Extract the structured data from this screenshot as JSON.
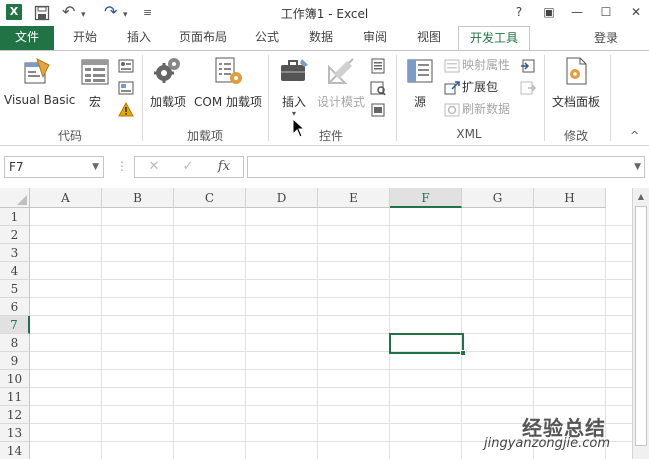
{
  "window": {
    "title": "工作簿1 - Excel",
    "app_logo": "X",
    "controls": [
      "?",
      "▣",
      "—",
      "☐",
      "✕"
    ]
  },
  "qat": {
    "undo": "↶",
    "redo": "↷",
    "customize": "≡"
  },
  "tabs": [
    {
      "label": "文件"
    },
    {
      "label": "开始"
    },
    {
      "label": "插入"
    },
    {
      "label": "页面布局"
    },
    {
      "label": "公式"
    },
    {
      "label": "数据"
    },
    {
      "label": "审阅"
    },
    {
      "label": "视图"
    },
    {
      "label": "开发工具"
    }
  ],
  "account": {
    "login": "登录"
  },
  "ribbon": {
    "groups": {
      "code": {
        "label": "代码",
        "visual_basic": "Visual Basic",
        "macros": "宏"
      },
      "addins": {
        "label": "加载项",
        "addins_btn": "加载项",
        "com_addins": "COM 加载项"
      },
      "controls": {
        "label": "控件",
        "insert": "插入",
        "design_mode": "设计模式"
      },
      "xml": {
        "label": "XML",
        "source": "源",
        "map_properties": "映射属性",
        "expansion_packs": "扩展包",
        "refresh_data": "刷新数据"
      },
      "modify": {
        "label": "修改",
        "document_panel": "文档面板"
      }
    },
    "collapse": "^"
  },
  "formula_bar": {
    "name_box": "F7",
    "fx": "fx",
    "cancel": "✕",
    "enter": "✓",
    "formula": ""
  },
  "sheet": {
    "columns": [
      "A",
      "B",
      "C",
      "D",
      "E",
      "F",
      "G",
      "H"
    ],
    "rows": [
      "1",
      "2",
      "3",
      "4",
      "5",
      "6",
      "7",
      "8",
      "9",
      "10",
      "11",
      "12",
      "13",
      "14"
    ],
    "active_cell": "F7",
    "active_column": "F",
    "active_row": "7"
  },
  "watermark": {
    "cn": "经验总结",
    "url": "jingyanzongjie.com"
  },
  "colors": {
    "accent": "#217346",
    "grid": "#e1e1e1",
    "header_bg": "#f3f3f3",
    "macro_warning": "#e6a800"
  }
}
